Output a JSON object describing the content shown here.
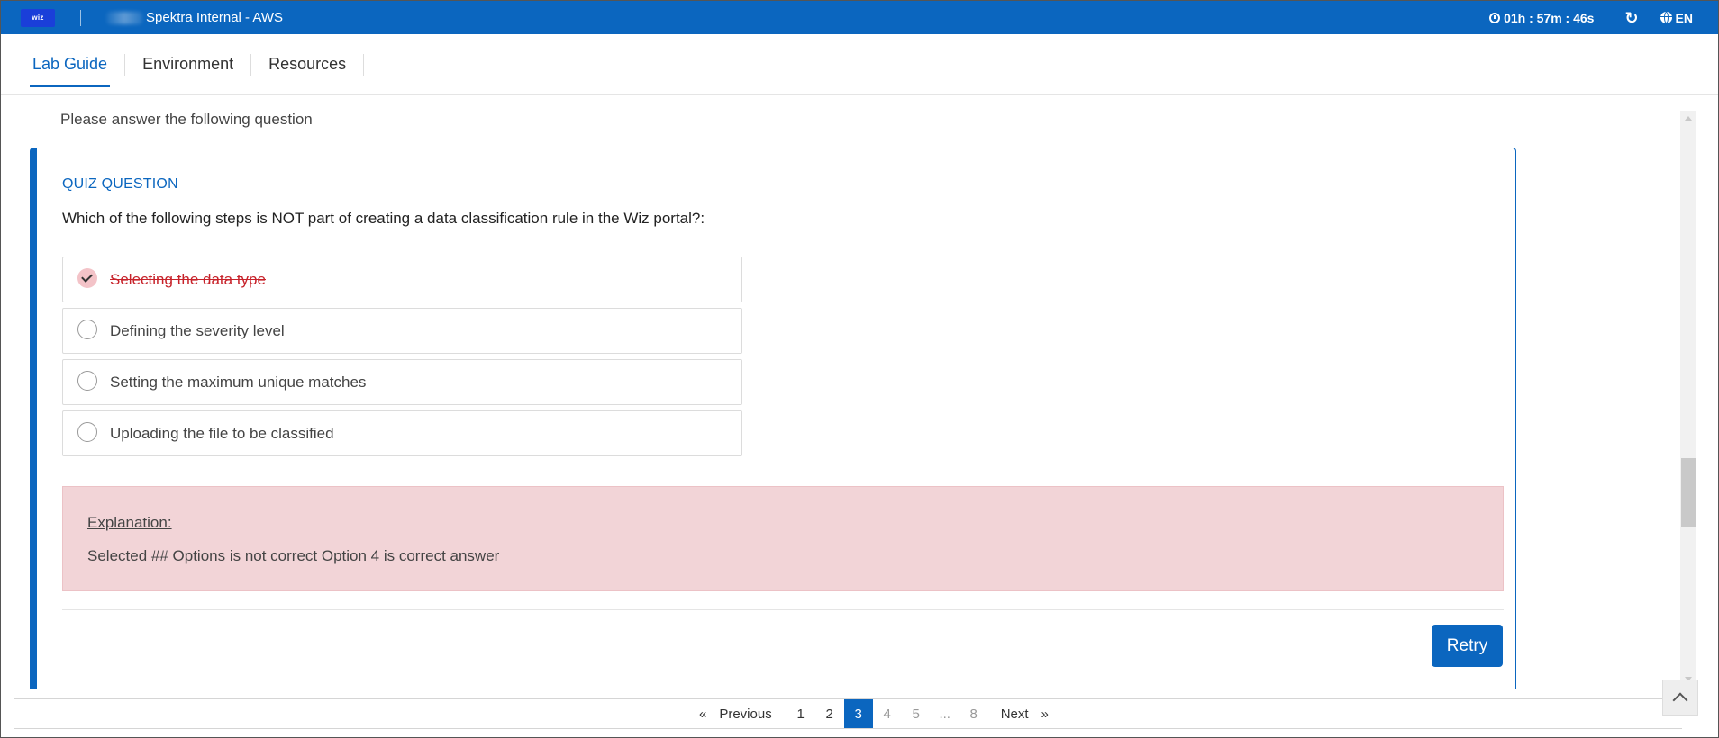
{
  "topbar": {
    "logo_text": "wiz",
    "title": "Spektra Internal - AWS",
    "timer": "01h : 57m : 46s",
    "refresh_icon": "refresh-icon",
    "language": "EN",
    "bg_color": "#0b66bf"
  },
  "tabs": [
    {
      "label": "Lab Guide",
      "active": true
    },
    {
      "label": "Environment",
      "active": false
    },
    {
      "label": "Resources",
      "active": false
    }
  ],
  "content": {
    "intro": "Please answer the following question"
  },
  "quiz": {
    "label": "QUIZ QUESTION",
    "question": "Which of the following steps is NOT part of creating a data classification rule in the Wiz portal?:",
    "options": [
      {
        "text": "Selecting the data type",
        "selected": true,
        "state": "incorrect"
      },
      {
        "text": "Defining the severity level",
        "selected": false
      },
      {
        "text": "Setting the maximum unique matches",
        "selected": false
      },
      {
        "text": "Uploading the file to be classified",
        "selected": false
      }
    ],
    "explanation_title": "Explanation:",
    "explanation_text": "Selected ## Options is not correct Option 4 is correct answer",
    "retry_label": "Retry"
  },
  "pagination": {
    "prev_symbol": "«",
    "prev_label": "Previous",
    "pages": [
      "1",
      "2",
      "3",
      "4",
      "5",
      "...",
      "8"
    ],
    "current": "3",
    "next_label": "Next",
    "next_symbol": "»"
  },
  "colors": {
    "accent": "#0b66bf",
    "error": "#c7222a",
    "explanation_bg": "#f2d4d7"
  }
}
